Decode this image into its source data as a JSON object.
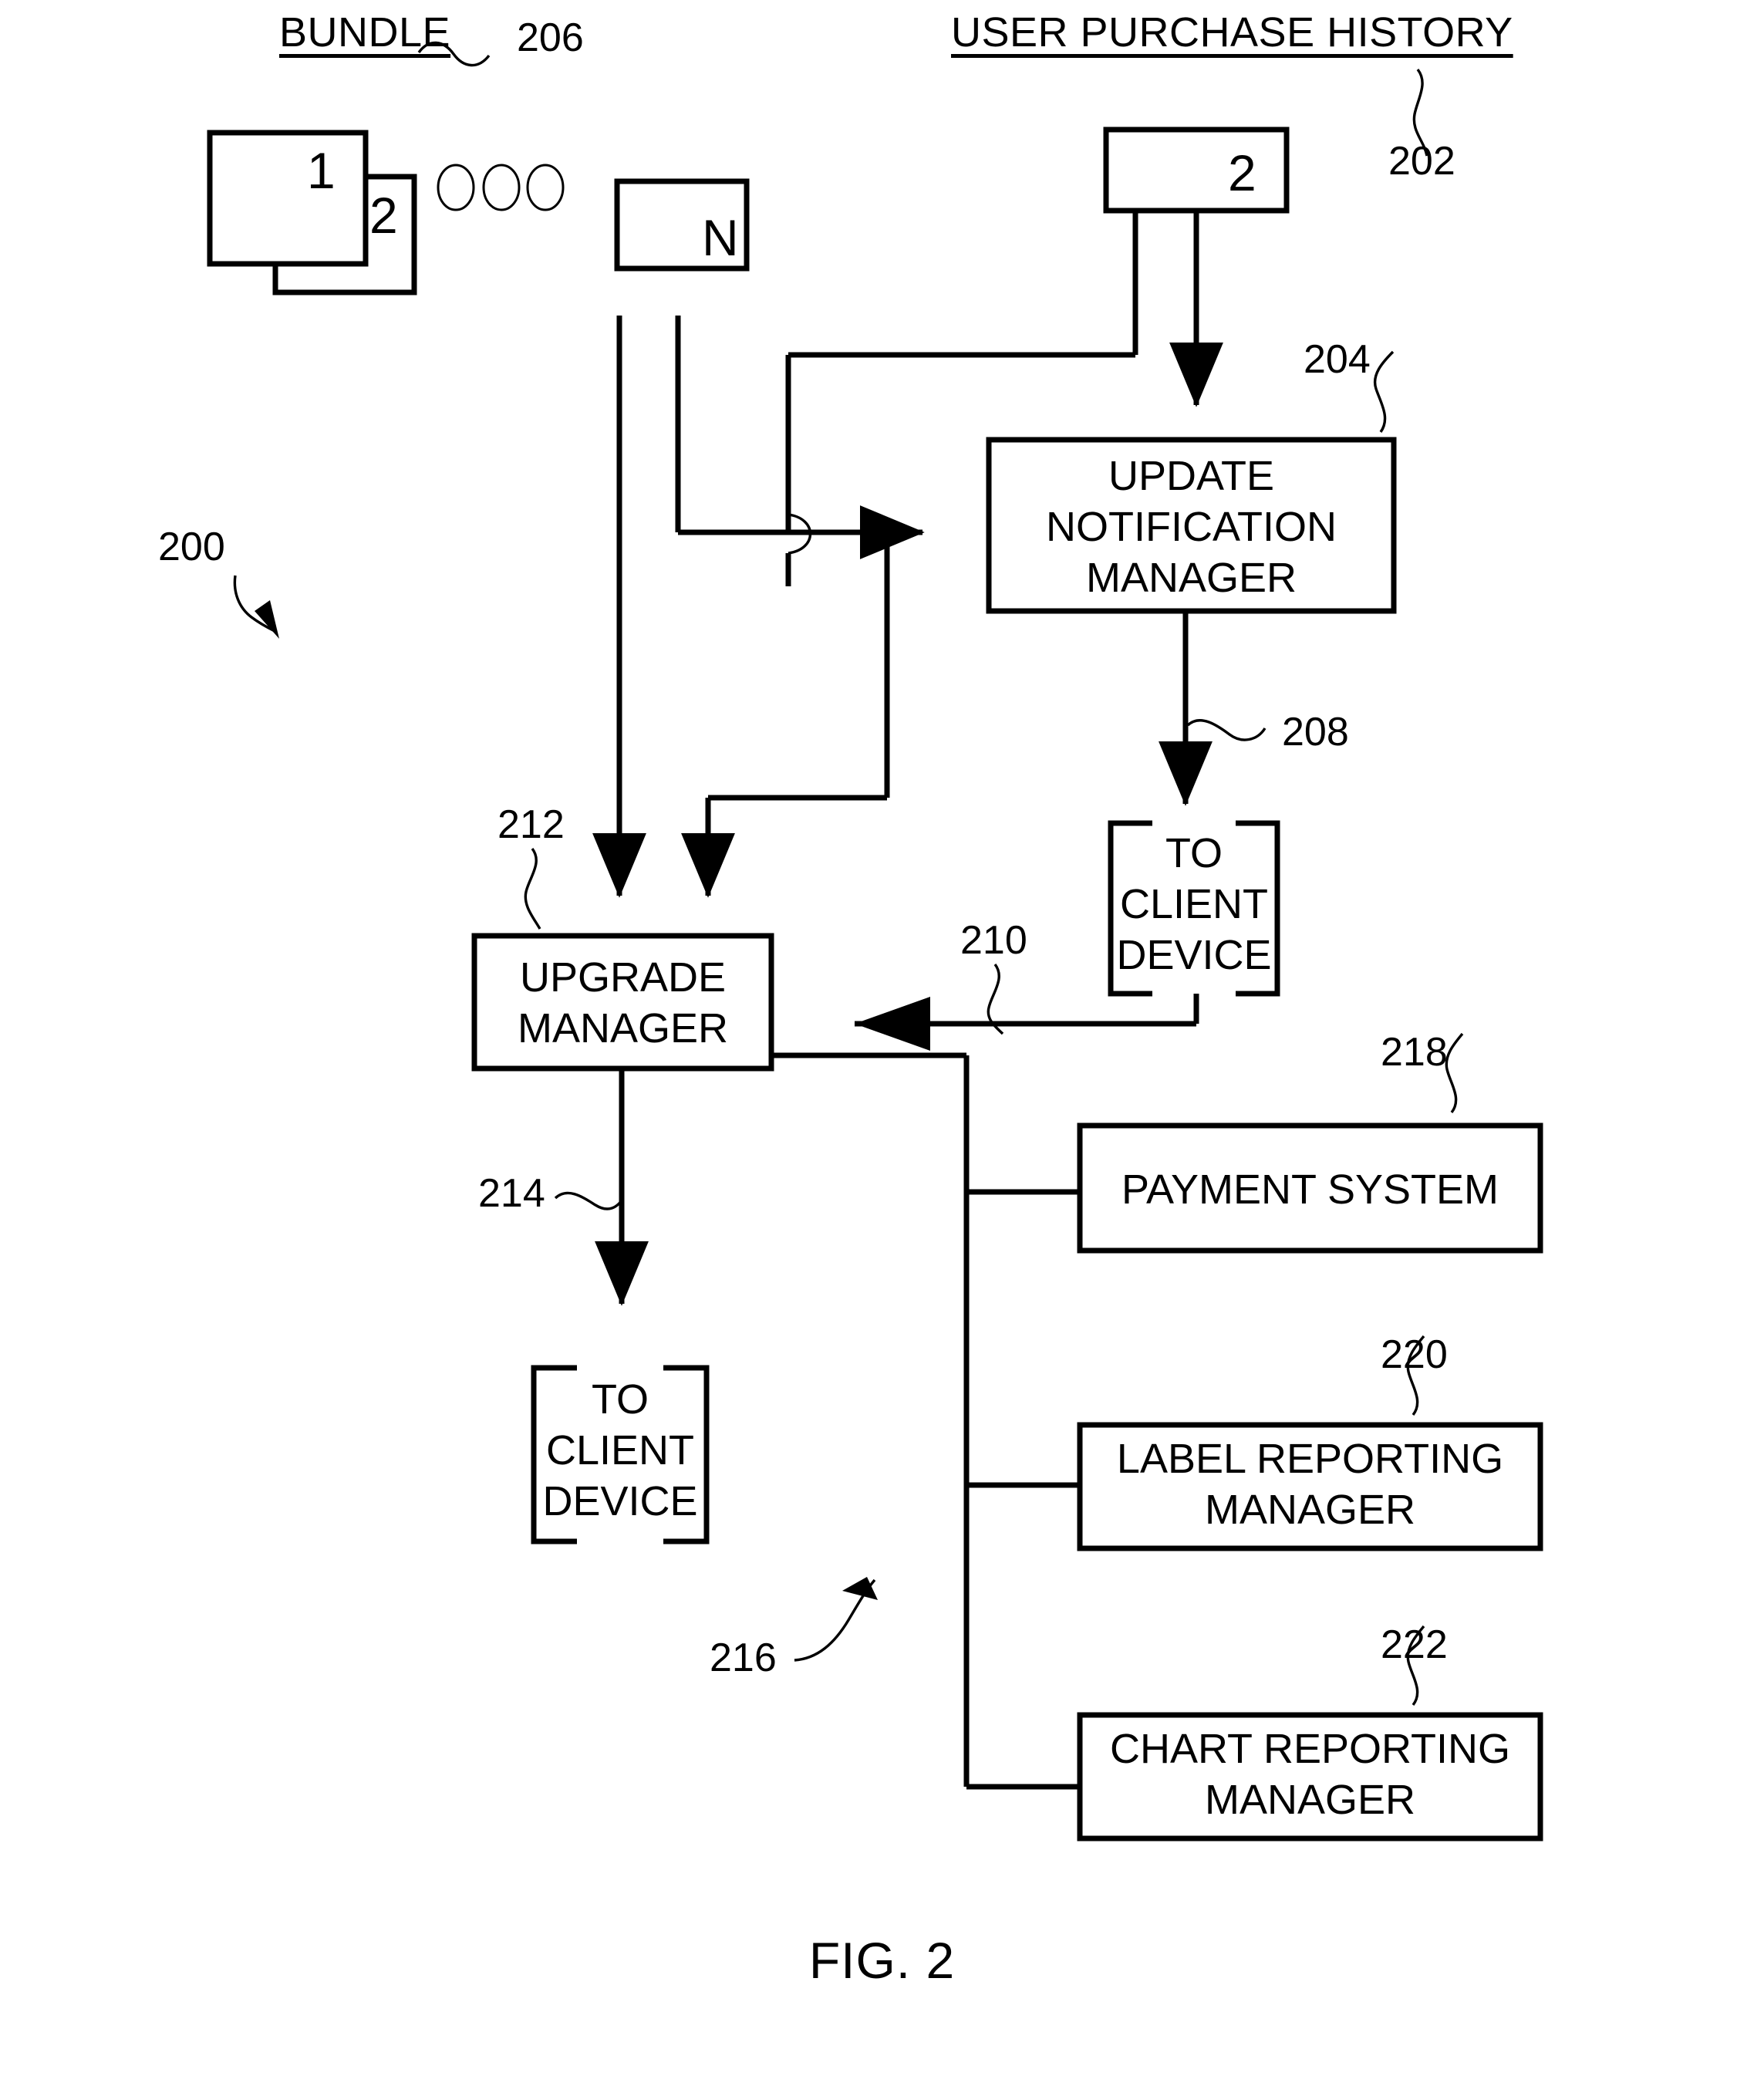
{
  "figure": {
    "caption": "FIG. 2",
    "system_ref": "200"
  },
  "sections": {
    "bundle": {
      "title": "BUNDLE",
      "ref": "206",
      "items": [
        {
          "label": "1"
        },
        {
          "label": "2"
        },
        {
          "label": "N"
        }
      ],
      "ellipsis": "○ ○ ○"
    },
    "purchase_history": {
      "title": "USER PURCHASE HISTORY",
      "ref": "202",
      "items": [
        {
          "label": "2"
        }
      ]
    }
  },
  "blocks": [
    {
      "id": "update-notification-manager",
      "lines": [
        "UPDATE",
        "NOTIFICATION",
        "MANAGER"
      ],
      "ref": "204"
    },
    {
      "id": "to-client-device-upper",
      "lines": [
        "TO",
        "CLIENT",
        "DEVICE"
      ],
      "ref": "208"
    },
    {
      "id": "upgrade-manager",
      "lines": [
        "UPGRADE",
        "MANAGER"
      ],
      "ref": "212"
    },
    {
      "id": "to-client-device-lower",
      "lines": [
        "TO",
        "CLIENT",
        "DEVICE"
      ],
      "ref": "214"
    },
    {
      "id": "payment-system",
      "lines": [
        "PAYMENT SYSTEM"
      ],
      "ref": "218"
    },
    {
      "id": "label-reporting-manager",
      "lines": [
        "LABEL REPORTING",
        "MANAGER"
      ],
      "ref": "220"
    },
    {
      "id": "chart-reporting-manager",
      "lines": [
        "CHART REPORTING",
        "MANAGER"
      ],
      "ref": "222"
    }
  ],
  "connectors": [
    {
      "id": "feedback-to-upgrade-manager",
      "ref": "210"
    },
    {
      "id": "upgrade-manager-bus",
      "ref": "216"
    }
  ],
  "text": {
    "bundle_title": "BUNDLE",
    "bundle_ref": "206",
    "bundle_item_1": "1",
    "bundle_item_2": "2",
    "bundle_item_n": "N",
    "history_title": "USER PURCHASE HISTORY",
    "history_ref": "202",
    "history_item_2": "2",
    "unm_l1": "UPDATE",
    "unm_l2": "NOTIFICATION",
    "unm_l3": "MANAGER",
    "unm_ref": "204",
    "tcd_upper_l1": "TO",
    "tcd_upper_l2": "CLIENT",
    "tcd_upper_l3": "DEVICE",
    "tcd_upper_ref": "208",
    "um_l1": "UPGRADE",
    "um_l2": "MANAGER",
    "um_ref": "212",
    "tcd_lower_l1": "TO",
    "tcd_lower_l2": "CLIENT",
    "tcd_lower_l3": "DEVICE",
    "tcd_lower_ref": "214",
    "ps_l1": "PAYMENT SYSTEM",
    "ps_ref": "218",
    "lrm_l1": "LABEL REPORTING",
    "lrm_l2": "MANAGER",
    "lrm_ref": "220",
    "crm_l1": "CHART REPORTING",
    "crm_l2": "MANAGER",
    "crm_ref": "222",
    "feedback_ref": "210",
    "bus_ref": "216",
    "system_ref": "200",
    "caption": "FIG. 2"
  },
  "colors": {
    "ink": "#000000",
    "paper": "#ffffff"
  }
}
